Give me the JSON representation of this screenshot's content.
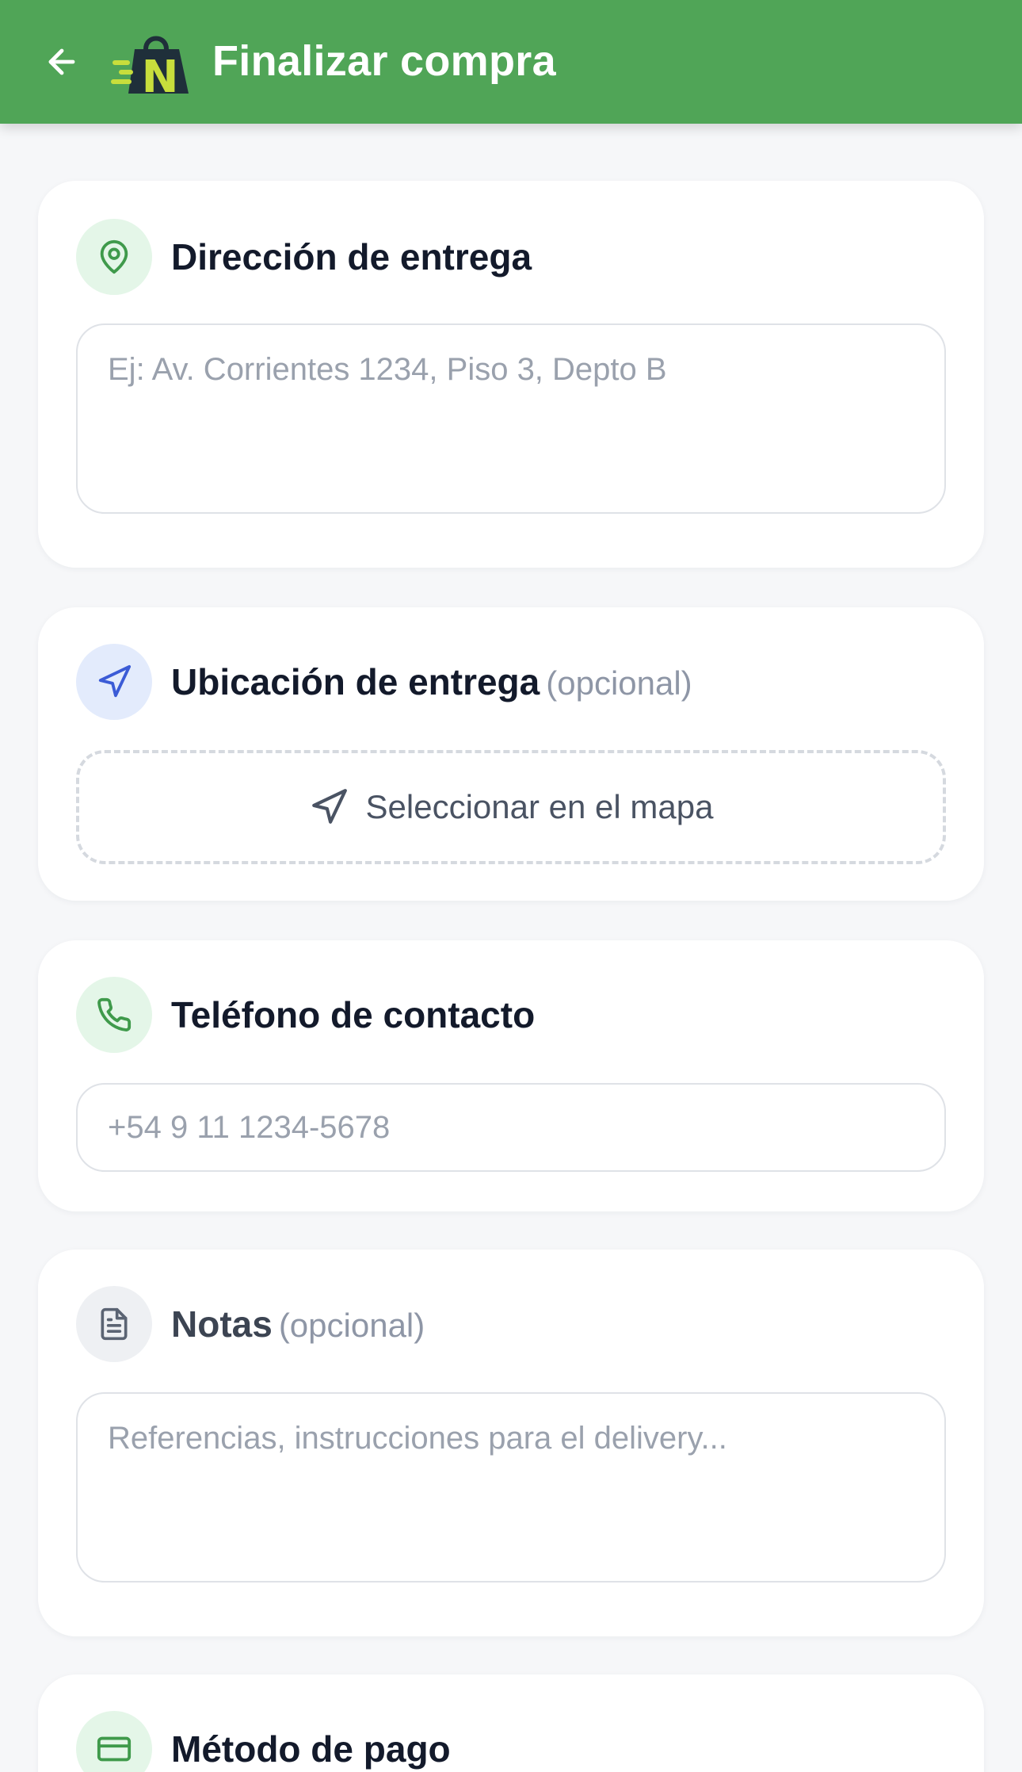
{
  "header": {
    "title": "Finalizar compra",
    "logo_letter": "N",
    "color": "#50a557"
  },
  "sections": {
    "address": {
      "title": "Dirección de entrega",
      "placeholder": "Ej: Av. Corrientes 1234, Piso 3, Depto B",
      "icon": "map-pin-icon"
    },
    "location": {
      "title": "Ubicación de entrega",
      "optional": "(opcional)",
      "button_label": "Seleccionar en el mapa",
      "icon": "navigation-icon"
    },
    "phone": {
      "title": "Teléfono de contacto",
      "placeholder": "+54 9 11 1234-5678",
      "icon": "phone-icon"
    },
    "notes": {
      "title": "Notas",
      "optional": "(opcional)",
      "placeholder": "Referencias, instrucciones para el delivery...",
      "icon": "document-icon"
    },
    "payment": {
      "title": "Método de pago",
      "icon": "credit-card-icon"
    }
  },
  "colors": {
    "green_accent": "#3f9a4b",
    "green_icon_bg": "#e4f6e8",
    "blue_accent": "#3b5bd6",
    "blue_icon_bg": "#e3ebfc",
    "gray_icon_bg": "#eef0f3"
  }
}
